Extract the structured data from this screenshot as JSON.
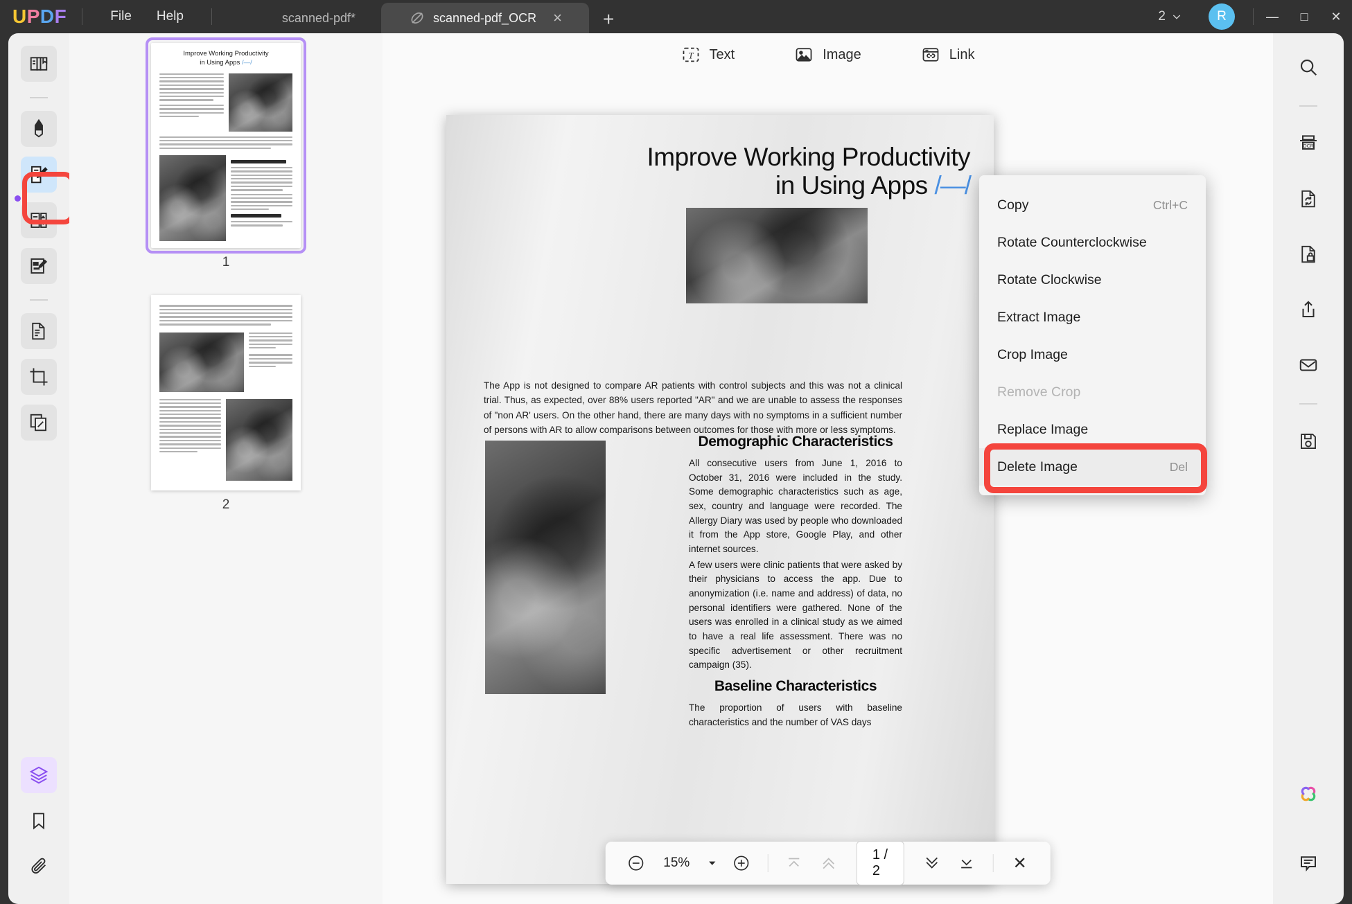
{
  "titlebar": {
    "logo_letters": [
      "U",
      "P",
      "D",
      "F"
    ],
    "menus": [
      {
        "name": "file",
        "label": "File"
      },
      {
        "name": "help",
        "label": "Help"
      }
    ],
    "tabs": [
      {
        "name": "tab-scanned-pdf",
        "label": "scanned-pdf*",
        "active": false
      },
      {
        "name": "tab-scanned-pdf-ocr",
        "label": "scanned-pdf_OCR",
        "active": true
      }
    ],
    "new_tab_glyph": "+",
    "tab_close_glyph": "×",
    "page_count_label": "2",
    "avatar_initial": "R",
    "window": {
      "minimize": "—",
      "maximize": "□",
      "close": "✕"
    },
    "colors": {
      "bar_bg": "#323232",
      "active_tab_bg": "#4a4a4a",
      "avatar_bg": "#5bc0f0"
    }
  },
  "left_rail": {
    "items": [
      {
        "name": "sidebar-item-reader",
        "icon": "book-reader-icon"
      },
      {
        "name": "sidebar-item-comment",
        "icon": "highlighter-pen-icon"
      },
      {
        "name": "sidebar-item-edit-pdf",
        "icon": "edit-document-pen-icon",
        "selected": true
      },
      {
        "name": "sidebar-item-organize-pages",
        "icon": "page-list-icon"
      },
      {
        "name": "sidebar-item-fill-sign",
        "icon": "form-sign-icon"
      },
      {
        "name": "sidebar-item-convert",
        "icon": "document-copy-icon"
      },
      {
        "name": "sidebar-item-crop",
        "icon": "crop-icon"
      },
      {
        "name": "sidebar-item-batch",
        "icon": "stacked-pages-icon"
      }
    ],
    "bottom_items": [
      {
        "name": "sidebar-item-layers",
        "icon": "layers-icon",
        "active": true
      },
      {
        "name": "sidebar-item-bookmark",
        "icon": "bookmark-icon"
      },
      {
        "name": "sidebar-item-attachment",
        "icon": "paperclip-icon"
      }
    ],
    "highlight_color": "#f4453d"
  },
  "thumbnails": {
    "pages": [
      {
        "name": "thumbnail-page-1",
        "number": "1",
        "selected": true
      },
      {
        "name": "thumbnail-page-2",
        "number": "2",
        "selected": false
      }
    ],
    "selection_color": "#b58ff5"
  },
  "edit_toolbar": {
    "items": [
      {
        "name": "toolbar-text",
        "label": "Text",
        "icon": "text-tool-icon"
      },
      {
        "name": "toolbar-image",
        "label": "Image",
        "icon": "image-tool-icon"
      },
      {
        "name": "toolbar-link",
        "label": "Link",
        "icon": "link-tool-icon"
      }
    ]
  },
  "context_menu": {
    "items": [
      {
        "name": "ctx-copy",
        "label": "Copy",
        "shortcut": "Ctrl+C",
        "disabled": false,
        "highlighted": false
      },
      {
        "name": "ctx-rotate-ccw",
        "label": "Rotate Counterclockwise",
        "shortcut": "",
        "disabled": false,
        "highlighted": false
      },
      {
        "name": "ctx-rotate-cw",
        "label": "Rotate Clockwise",
        "shortcut": "",
        "disabled": false,
        "highlighted": false
      },
      {
        "name": "ctx-extract-image",
        "label": "Extract Image",
        "shortcut": "",
        "disabled": false,
        "highlighted": false
      },
      {
        "name": "ctx-crop-image",
        "label": "Crop Image",
        "shortcut": "",
        "disabled": false,
        "highlighted": false
      },
      {
        "name": "ctx-remove-crop",
        "label": "Remove Crop",
        "shortcut": "",
        "disabled": true,
        "highlighted": false
      },
      {
        "name": "ctx-replace-image",
        "label": "Replace Image",
        "shortcut": "",
        "disabled": false,
        "highlighted": false
      },
      {
        "name": "ctx-delete-image",
        "label": "Delete Image",
        "shortcut": "Del",
        "disabled": false,
        "highlighted": true
      }
    ],
    "highlight_color": "#f4453d"
  },
  "document": {
    "title_line1": "Improve Working Productivity",
    "title_line2": "in Using Apps",
    "title_bracket": "/—/",
    "paragraph1": "The App is not designed to compare AR patients with control subjects and this was not a clinical trial. Thus, as expected, over 88% users reported \"AR\" and we are unable to assess the responses of \"non AR' users. On the other hand, there are many days with no symptoms in a sufficient number of persons with AR to allow comparisons between outcomes for those with more or less symptoms.",
    "section1_heading": "Demographic Characteristics",
    "section1_p1": "All consecutive users from June 1, 2016 to October 31, 2016 were included in the study. Some demographic characteristics such as age, sex, country and language were recorded. The Allergy Diary was used by people who downloaded it from the App store, Google Play, and other internet sources.",
    "section1_p2": "A few users were clinic patients that were asked by their physicians to access the app. Due to anonymization (i.e. name and address) of data, no personal identifiers were gathered. None of the users was enrolled in a clinical study as we aimed to have a real life assessment. There was no specific advertisement or other   recruitment campaign (35).",
    "section2_heading": "Baseline Characteristics",
    "section2_p1": "The proportion of users with baseline characteristics and the number of VAS days"
  },
  "bottom_toolbar": {
    "zoom_out": {
      "name": "zoom-out-button",
      "glyph": "−"
    },
    "zoom_value": "15%",
    "zoom_dropdown": {
      "name": "zoom-dropdown",
      "glyph": "▾"
    },
    "zoom_in": {
      "name": "zoom-in-button",
      "glyph": "+"
    },
    "first_page": {
      "name": "first-page-button",
      "disabled": true
    },
    "prev_page": {
      "name": "previous-page-button",
      "disabled": true
    },
    "page_indicator": "1 / 2",
    "next_page": {
      "name": "next-page-button",
      "disabled": false
    },
    "last_page": {
      "name": "last-page-button",
      "disabled": false
    },
    "close": {
      "name": "close-toolbar-button",
      "glyph": "✕"
    }
  },
  "right_rail": {
    "items": [
      {
        "name": "search-button",
        "icon": "search-icon"
      },
      {
        "name": "ocr-button",
        "icon": "ocr-icon"
      },
      {
        "name": "convert-button",
        "icon": "document-refresh-icon"
      },
      {
        "name": "protect-button",
        "icon": "document-lock-icon"
      },
      {
        "name": "share-button",
        "icon": "share-upload-icon"
      },
      {
        "name": "email-button",
        "icon": "envelope-icon"
      },
      {
        "name": "save-button",
        "icon": "floppy-save-icon"
      }
    ],
    "bottom_items": [
      {
        "name": "ai-assistant-button",
        "icon": "ai-flower-icon"
      },
      {
        "name": "comment-button",
        "icon": "comment-bubble-icon"
      }
    ]
  }
}
